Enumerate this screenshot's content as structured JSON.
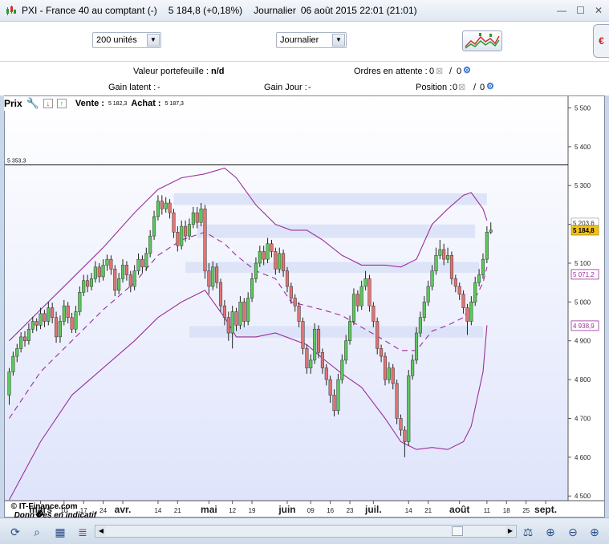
{
  "window": {
    "title": "PXI - France 40 au comptant (-)",
    "quote": "5 184,8 (+0,18%)",
    "period": "Journalier",
    "datetime": "06 août 2015 22:01 (21:01)"
  },
  "toolbar": {
    "units_value": "200 unités",
    "period_value": "Journalier",
    "side_tab_label": "€"
  },
  "portfolio": {
    "valeur_label": "Valeur portefeuille :",
    "valeur_value": "n/d",
    "ordres_label": "Ordres en attente :",
    "ordres_value": "0",
    "ordres_value2": "0",
    "gain_latent_label": "Gain latent :",
    "gain_latent_value": "-",
    "gain_jour_label": "Gain Jour :",
    "gain_jour_value": "-",
    "position_label": "Position :",
    "position_value": "0",
    "position_value2": "0"
  },
  "legend": {
    "prix": "Prix",
    "vente_label": "Vente :",
    "vente_value": "5 182,3",
    "achat_label": "Achat :",
    "achat_value": "5 187,3"
  },
  "chart_data": {
    "type": "candlestick",
    "instrument": "PXI - France 40 au comptant (-)",
    "y_ticks": [
      4500,
      4600,
      4700,
      4800,
      4900,
      5000,
      5100,
      5200,
      5300,
      5400,
      5500
    ],
    "y_tick_labels": [
      "4 500",
      "4 600",
      "4 700",
      "4 800",
      "4 900",
      "5 000",
      "5 100",
      "5 200",
      "5 300",
      "5 400",
      "5 500"
    ],
    "ylim": [
      4488,
      5530
    ],
    "x_labels": [
      {
        "label": "mars",
        "bold": true,
        "i": 8
      },
      {
        "label": "10",
        "bold": false,
        "i": 14
      },
      {
        "label": "17",
        "bold": false,
        "i": 19
      },
      {
        "label": "24",
        "bold": false,
        "i": 24
      },
      {
        "label": "avr.",
        "bold": true,
        "i": 29
      },
      {
        "label": "14",
        "bold": false,
        "i": 38
      },
      {
        "label": "21",
        "bold": false,
        "i": 43
      },
      {
        "label": "mai",
        "bold": true,
        "i": 51
      },
      {
        "label": "12",
        "bold": false,
        "i": 57
      },
      {
        "label": "19",
        "bold": false,
        "i": 62
      },
      {
        "label": "juin",
        "bold": true,
        "i": 71
      },
      {
        "label": "09",
        "bold": false,
        "i": 77
      },
      {
        "label": "16",
        "bold": false,
        "i": 82
      },
      {
        "label": "23",
        "bold": false,
        "i": 87
      },
      {
        "label": "juil.",
        "bold": true,
        "i": 93
      },
      {
        "label": "14",
        "bold": false,
        "i": 102
      },
      {
        "label": "21",
        "bold": false,
        "i": 107
      },
      {
        "label": "août",
        "bold": true,
        "i": 115
      },
      {
        "label": "11",
        "bold": false,
        "i": 122
      },
      {
        "label": "18",
        "bold": false,
        "i": 127
      },
      {
        "label": "25",
        "bold": false,
        "i": 132
      },
      {
        "label": "sept.",
        "bold": true,
        "i": 137
      }
    ],
    "reference_line": {
      "value": 5353.3,
      "label": "5 353,3"
    },
    "price_tags": [
      {
        "value": 5203.6,
        "label": "5 203,6",
        "style": "plain"
      },
      {
        "value": 5184.8,
        "label": "5 184,8",
        "style": "current"
      },
      {
        "value": 5071.2,
        "label": "5 071,2",
        "style": "band"
      },
      {
        "value": 4938.9,
        "label": "4 938,9",
        "style": "band"
      }
    ],
    "zones": [
      {
        "from_i": 42,
        "to_i": 122,
        "low": 5250,
        "high": 5280
      },
      {
        "from_i": 48,
        "to_i": 119,
        "low": 5165,
        "high": 5200
      },
      {
        "from_i": 45,
        "to_i": 120,
        "low": 5075,
        "high": 5103
      },
      {
        "from_i": 46,
        "to_i": 121,
        "low": 4908,
        "high": 4938
      }
    ],
    "bollinger": {
      "upper": [
        [
          0,
          4900
        ],
        [
          8,
          4980
        ],
        [
          16,
          5060
        ],
        [
          24,
          5140
        ],
        [
          32,
          5230
        ],
        [
          38,
          5290
        ],
        [
          44,
          5320
        ],
        [
          50,
          5330
        ],
        [
          55,
          5345
        ],
        [
          58,
          5320
        ],
        [
          63,
          5250
        ],
        [
          68,
          5200
        ],
        [
          72,
          5185
        ],
        [
          76,
          5185
        ],
        [
          80,
          5160
        ],
        [
          85,
          5120
        ],
        [
          90,
          5095
        ],
        [
          96,
          5095
        ],
        [
          100,
          5090
        ],
        [
          104,
          5110
        ],
        [
          108,
          5200
        ],
        [
          112,
          5240
        ],
        [
          116,
          5275
        ],
        [
          118,
          5282
        ],
        [
          121,
          5240
        ],
        [
          122,
          5210
        ]
      ],
      "middle": [
        [
          0,
          4700
        ],
        [
          8,
          4820
        ],
        [
          16,
          4900
        ],
        [
          24,
          4980
        ],
        [
          32,
          5050
        ],
        [
          38,
          5120
        ],
        [
          44,
          5160
        ],
        [
          50,
          5180
        ],
        [
          55,
          5150
        ],
        [
          58,
          5120
        ],
        [
          63,
          5080
        ],
        [
          68,
          5060
        ],
        [
          72,
          5000
        ],
        [
          76,
          4990
        ],
        [
          80,
          4980
        ],
        [
          85,
          4965
        ],
        [
          90,
          4935
        ],
        [
          96,
          4900
        ],
        [
          100,
          4875
        ],
        [
          104,
          4875
        ],
        [
          108,
          4925
        ],
        [
          112,
          4940
        ],
        [
          116,
          4960
        ],
        [
          118,
          4990
        ],
        [
          121,
          5050
        ],
        [
          122,
          5090
        ]
      ],
      "lower": [
        [
          0,
          4490
        ],
        [
          8,
          4640
        ],
        [
          16,
          4760
        ],
        [
          24,
          4830
        ],
        [
          32,
          4900
        ],
        [
          38,
          4960
        ],
        [
          44,
          5000
        ],
        [
          50,
          5030
        ],
        [
          55,
          4960
        ],
        [
          58,
          4910
        ],
        [
          63,
          4910
        ],
        [
          68,
          4920
        ],
        [
          72,
          4905
        ],
        [
          76,
          4890
        ],
        [
          80,
          4855
        ],
        [
          85,
          4815
        ],
        [
          90,
          4780
        ],
        [
          96,
          4700
        ],
        [
          100,
          4640
        ],
        [
          104,
          4620
        ],
        [
          108,
          4625
        ],
        [
          112,
          4620
        ],
        [
          116,
          4640
        ],
        [
          118,
          4680
        ],
        [
          121,
          4820
        ],
        [
          122,
          4940
        ]
      ]
    },
    "candles": [
      [
        4760,
        4820,
        4735,
        4830
      ],
      [
        4820,
        4860,
        4810,
        4872
      ],
      [
        4860,
        4880,
        4845,
        4892
      ],
      [
        4880,
        4910,
        4870,
        4922
      ],
      [
        4910,
        4900,
        4885,
        4925
      ],
      [
        4900,
        4930,
        4890,
        4945
      ],
      [
        4930,
        4950,
        4920,
        4962
      ],
      [
        4950,
        4940,
        4925,
        4958
      ],
      [
        4940,
        4970,
        4930,
        4985
      ],
      [
        4970,
        4950,
        4935,
        4980
      ],
      [
        4950,
        4985,
        4940,
        5000
      ],
      [
        4985,
        4960,
        4945,
        4998
      ],
      [
        4960,
        4910,
        4895,
        4975
      ],
      [
        4910,
        4950,
        4895,
        4965
      ],
      [
        4950,
        4990,
        4940,
        5005
      ],
      [
        4990,
        4960,
        4945,
        5000
      ],
      [
        4960,
        4930,
        4920,
        4972
      ],
      [
        4930,
        4975,
        4920,
        4990
      ],
      [
        4975,
        5025,
        4965,
        5040
      ],
      [
        5025,
        5055,
        5015,
        5070
      ],
      [
        5055,
        5040,
        5025,
        5070
      ],
      [
        5040,
        5060,
        5030,
        5075
      ],
      [
        5060,
        5090,
        5050,
        5105
      ],
      [
        5090,
        5065,
        5050,
        5100
      ],
      [
        5065,
        5095,
        5055,
        5110
      ],
      [
        5095,
        5110,
        5080,
        5122
      ],
      [
        5110,
        5085,
        5070,
        5120
      ],
      [
        5085,
        5030,
        5015,
        5095
      ],
      [
        5030,
        5060,
        5020,
        5075
      ],
      [
        5060,
        5095,
        5050,
        5110
      ],
      [
        5095,
        5070,
        5055,
        5105
      ],
      [
        5070,
        5040,
        5025,
        5080
      ],
      [
        5040,
        5080,
        5030,
        5095
      ],
      [
        5080,
        5110,
        5070,
        5125
      ],
      [
        5110,
        5090,
        5075,
        5120
      ],
      [
        5090,
        5125,
        5080,
        5140
      ],
      [
        5125,
        5170,
        5115,
        5185
      ],
      [
        5170,
        5220,
        5160,
        5235
      ],
      [
        5220,
        5260,
        5210,
        5275
      ],
      [
        5260,
        5240,
        5225,
        5275
      ],
      [
        5240,
        5255,
        5230,
        5270
      ],
      [
        5255,
        5230,
        5215,
        5265
      ],
      [
        5230,
        5180,
        5165,
        5240
      ],
      [
        5180,
        5145,
        5130,
        5195
      ],
      [
        5145,
        5195,
        5135,
        5210
      ],
      [
        5195,
        5170,
        5155,
        5210
      ],
      [
        5170,
        5200,
        5160,
        5215
      ],
      [
        5200,
        5230,
        5190,
        5245
      ],
      [
        5230,
        5205,
        5190,
        5245
      ],
      [
        5205,
        5240,
        5195,
        5255
      ],
      [
        5240,
        5080,
        5060,
        5250
      ],
      [
        5080,
        5040,
        5020,
        5100
      ],
      [
        5040,
        5090,
        5030,
        5105
      ],
      [
        5090,
        5050,
        5035,
        5100
      ],
      [
        5050,
        4990,
        4975,
        5060
      ],
      [
        4990,
        4960,
        4940,
        5005
      ],
      [
        4960,
        4920,
        4900,
        4975
      ],
      [
        4920,
        4975,
        4880,
        4990
      ],
      [
        4975,
        4940,
        4925,
        4985
      ],
      [
        4940,
        5000,
        4930,
        5015
      ],
      [
        5000,
        4950,
        4935,
        5010
      ],
      [
        4950,
        5010,
        4940,
        5025
      ],
      [
        5010,
        5060,
        5000,
        5075
      ],
      [
        5060,
        5100,
        5050,
        5115
      ],
      [
        5100,
        5130,
        5090,
        5145
      ],
      [
        5130,
        5110,
        5095,
        5145
      ],
      [
        5110,
        5150,
        5100,
        5165
      ],
      [
        5150,
        5130,
        5115,
        5160
      ],
      [
        5130,
        5085,
        5070,
        5140
      ],
      [
        5085,
        5125,
        5075,
        5140
      ],
      [
        5125,
        5080,
        5065,
        5135
      ],
      [
        5080,
        5040,
        5025,
        5090
      ],
      [
        5040,
        5010,
        4995,
        5050
      ],
      [
        5010,
        4990,
        4975,
        5020
      ],
      [
        4990,
        4950,
        4935,
        5000
      ],
      [
        4950,
        4880,
        4865,
        4960
      ],
      [
        4880,
        4830,
        4815,
        4890
      ],
      [
        4830,
        4850,
        4815,
        4865
      ],
      [
        4850,
        4930,
        4840,
        4945
      ],
      [
        4930,
        4870,
        4855,
        4940
      ],
      [
        4870,
        4830,
        4815,
        4880
      ],
      [
        4830,
        4800,
        4785,
        4840
      ],
      [
        4800,
        4760,
        4740,
        4810
      ],
      [
        4760,
        4720,
        4705,
        4775
      ],
      [
        4720,
        4800,
        4710,
        4815
      ],
      [
        4800,
        4850,
        4790,
        4865
      ],
      [
        4850,
        4900,
        4840,
        4915
      ],
      [
        4900,
        4950,
        4890,
        4965
      ],
      [
        4950,
        5020,
        4940,
        5035
      ],
      [
        5020,
        4990,
        4975,
        5030
      ],
      [
        4990,
        5040,
        4980,
        5055
      ],
      [
        5040,
        5060,
        5030,
        5080
      ],
      [
        5060,
        4990,
        4975,
        5070
      ],
      [
        4990,
        4950,
        4935,
        5000
      ],
      [
        4950,
        4880,
        4865,
        4960
      ],
      [
        4880,
        4860,
        4845,
        4890
      ],
      [
        4860,
        4800,
        4785,
        4870
      ],
      [
        4800,
        4830,
        4790,
        4845
      ],
      [
        4830,
        4790,
        4775,
        4840
      ],
      [
        4790,
        4700,
        4685,
        4800
      ],
      [
        4700,
        4670,
        4655,
        4710
      ],
      [
        4670,
        4640,
        4600,
        4680
      ],
      [
        4640,
        4810,
        4630,
        4825
      ],
      [
        4810,
        4850,
        4800,
        4865
      ],
      [
        4850,
        4920,
        4840,
        4935
      ],
      [
        4920,
        4960,
        4910,
        4975
      ],
      [
        4960,
        5000,
        4950,
        5015
      ],
      [
        5000,
        5040,
        4990,
        5055
      ],
      [
        5040,
        5080,
        5030,
        5095
      ],
      [
        5080,
        5120,
        5070,
        5140
      ],
      [
        5120,
        5135,
        5110,
        5160
      ],
      [
        5135,
        5110,
        5095,
        5150
      ],
      [
        5110,
        5120,
        5100,
        5140
      ],
      [
        5120,
        5060,
        5045,
        5130
      ],
      [
        5060,
        5040,
        5025,
        5070
      ],
      [
        5040,
        5020,
        5005,
        5050
      ],
      [
        5020,
        4985,
        4970,
        5030
      ],
      [
        4985,
        4950,
        4915,
        4995
      ],
      [
        4950,
        5000,
        4940,
        5015
      ],
      [
        5000,
        5050,
        4990,
        5065
      ],
      [
        5050,
        5070,
        5040,
        5085
      ],
      [
        5070,
        5110,
        5060,
        5125
      ],
      [
        5110,
        5180,
        5100,
        5195
      ],
      [
        5180,
        5185,
        5175,
        5205
      ]
    ],
    "up_color": "#5cc85c",
    "down_color": "#e07474",
    "band_color": "#9b2f9b",
    "zone_color": "#d9e1f7"
  },
  "watermark": {
    "brand": "© IT-Finance.com",
    "note": "Donn�es en indicatif"
  }
}
